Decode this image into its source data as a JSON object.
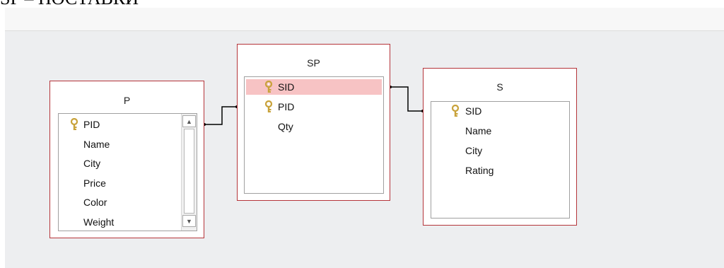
{
  "caption": "SP – ПОСТАВКИ",
  "tables": {
    "p": {
      "title": "P",
      "fields": [
        "PID",
        "Name",
        "City",
        "Price",
        "Color",
        "Weight"
      ],
      "keys": [
        "PID"
      ]
    },
    "sp": {
      "title": "SP",
      "fields": [
        "SID",
        "PID",
        "Qty"
      ],
      "keys": [
        "SID",
        "PID"
      ],
      "selected": "SID"
    },
    "s": {
      "title": "S",
      "fields": [
        "SID",
        "Name",
        "City",
        "Rating"
      ],
      "keys": [
        "SID"
      ]
    }
  },
  "colors": {
    "table_border": "#b5343a",
    "canvas": "#edeef0",
    "selected_row": "#f7c3c4",
    "key_icon": "#c8a23a"
  },
  "icons": {
    "primary_key": "key-icon",
    "scroll_up": "scroll-up-arrow-icon",
    "scroll_down": "scroll-down-arrow-icon"
  }
}
